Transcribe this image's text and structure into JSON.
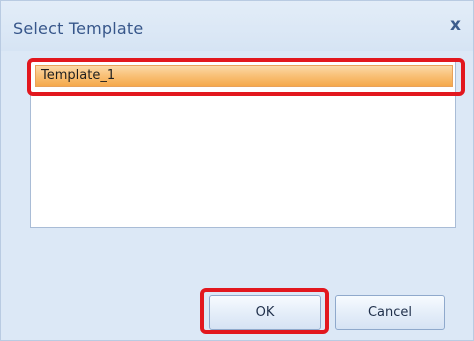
{
  "dialog": {
    "title": "Select Template",
    "close_glyph": "x"
  },
  "list": {
    "items": [
      {
        "label": "Template_1",
        "selected": true
      }
    ]
  },
  "buttons": {
    "ok_label": "OK",
    "cancel_label": "Cancel"
  },
  "colors": {
    "selection": "#f5a94b",
    "highlight_annotation": "#e2171e",
    "title_text": "#37568a"
  }
}
